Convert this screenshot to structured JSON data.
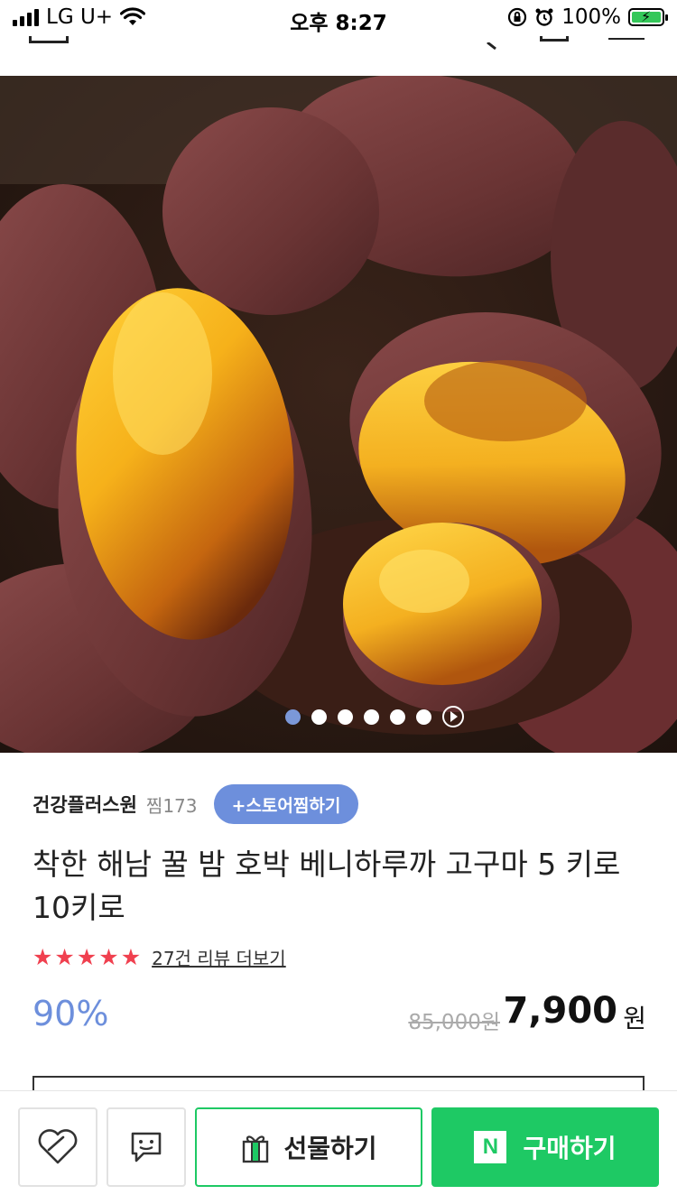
{
  "status_bar": {
    "carrier": "LG U+",
    "time": "오후 8:27",
    "battery": "100%"
  },
  "hero": {
    "image_count": 6,
    "active_index": 0
  },
  "product": {
    "store_name": "건강플러스원",
    "zzim_count": "찜173",
    "follow_label": "+스토어찜하기",
    "title": "착한 해남 꿀 밤 호박 베니하루까 고구마 5 키로 10키로",
    "stars": 5,
    "review_link": "27건 리뷰 더보기",
    "discount": "90%",
    "original_price": "85,000원",
    "sale_price": "7,900",
    "currency": "원"
  },
  "bottom_bar": {
    "gift_label": "선물하기",
    "buy_label": "구매하기",
    "brand_letter": "N"
  },
  "colors": {
    "accent_blue": "#6d8fdc",
    "star_red": "#f0404f",
    "naver_green": "#1ec964"
  }
}
